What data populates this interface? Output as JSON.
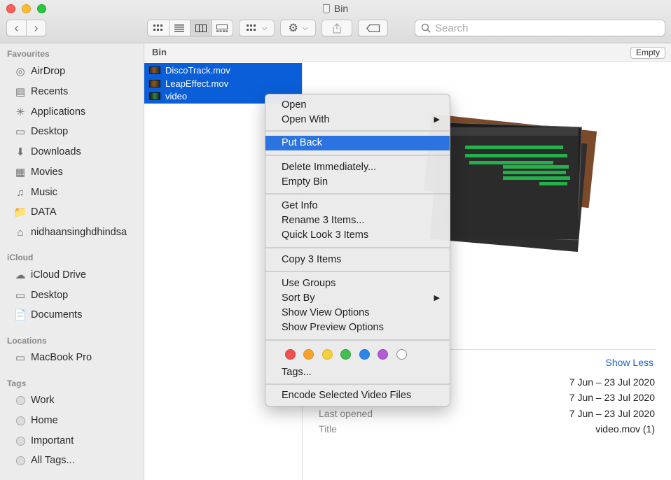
{
  "window": {
    "title": "Bin"
  },
  "toolbar": {
    "back": "‹",
    "forward": "›",
    "search_placeholder": "Search"
  },
  "sidebar": {
    "sections": {
      "favourites": "Favourites",
      "icloud": "iCloud",
      "locations": "Locations",
      "tags": "Tags"
    },
    "favourites": [
      {
        "label": "AirDrop",
        "icon": "airdrop-icon"
      },
      {
        "label": "Recents",
        "icon": "recents-icon"
      },
      {
        "label": "Applications",
        "icon": "applications-icon"
      },
      {
        "label": "Desktop",
        "icon": "desktop-icon"
      },
      {
        "label": "Downloads",
        "icon": "downloads-icon"
      },
      {
        "label": "Movies",
        "icon": "movies-icon"
      },
      {
        "label": "Music",
        "icon": "music-icon"
      },
      {
        "label": "DATA",
        "icon": "folder-icon"
      },
      {
        "label": "nidhaansinghdhindsa",
        "icon": "home-icon"
      }
    ],
    "icloud": [
      {
        "label": "iCloud Drive",
        "icon": "cloud-icon"
      },
      {
        "label": "Desktop",
        "icon": "desktop-icon"
      },
      {
        "label": "Documents",
        "icon": "documents-icon"
      }
    ],
    "locations": [
      {
        "label": "MacBook Pro",
        "icon": "laptop-icon"
      }
    ],
    "tags": [
      {
        "label": "Work"
      },
      {
        "label": "Home"
      },
      {
        "label": "Important"
      },
      {
        "label": "All Tags..."
      }
    ]
  },
  "pathbar": {
    "label": "Bin",
    "empty_button": "Empty"
  },
  "files": [
    {
      "name": "DiscoTrack.mov"
    },
    {
      "name": "LeapEffect.mov"
    },
    {
      "name": "video"
    }
  ],
  "context_menu": {
    "items": [
      "Open",
      "Open With",
      "Put Back",
      "Delete Immediately...",
      "Empty Bin",
      "Get Info",
      "Rename 3 Items...",
      "Quick Look 3 Items",
      "Copy 3 Items",
      "Use Groups",
      "Sort By",
      "Show View Options",
      "Show Preview Options",
      "Tags...",
      "Encode Selected Video Files"
    ],
    "tag_colors": [
      "#f0514f",
      "#f7a12e",
      "#f6cf3c",
      "#44c04f",
      "#2c86e9",
      "#b15bd7",
      "#ffffff"
    ]
  },
  "preview": {
    "show_less": "Show Less",
    "meta": [
      {
        "key": "",
        "value": "7 Jun – 23 Jul 2020"
      },
      {
        "key": "",
        "value": "7 Jun – 23 Jul 2020"
      },
      {
        "key": "Last opened",
        "value": "7 Jun – 23 Jul 2020"
      },
      {
        "key": "Title",
        "value": "video.mov (1)"
      }
    ]
  }
}
